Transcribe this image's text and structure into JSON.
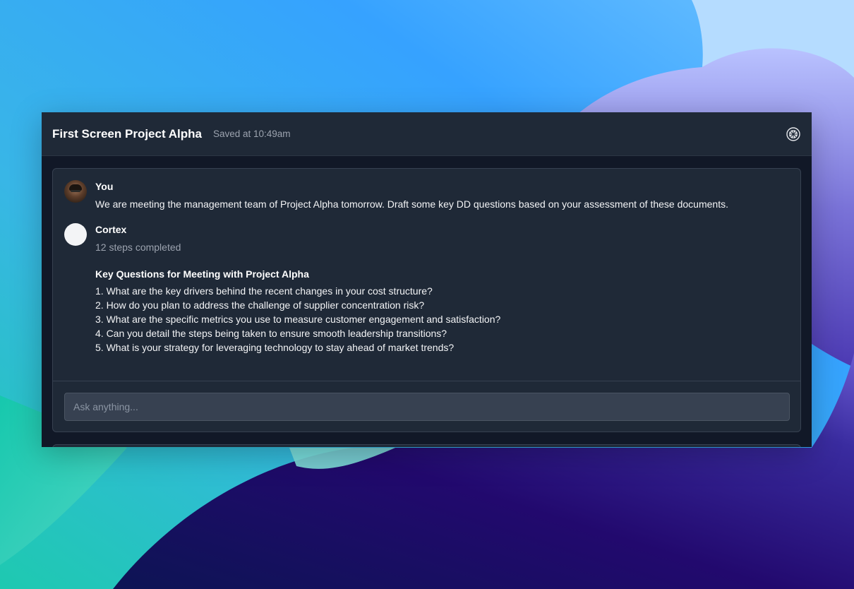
{
  "window": {
    "title": "First Screen Project Alpha",
    "saved_status": "Saved at 10:49am",
    "settings_icon": "settings-icon"
  },
  "conversation": {
    "user_message": {
      "sender": "You",
      "text": "We are meeting the management team of Project Alpha tomorrow. Draft some key DD questions based on your assessment of these documents."
    },
    "assistant_message": {
      "sender": "Cortex",
      "status": "12 steps completed",
      "answer_title": "Key Questions for Meeting with Project Alpha",
      "questions": [
        "1. What are the key drivers behind the recent changes in your cost structure?",
        "2. How do you plan to address the challenge of supplier concentration risk?",
        "3. What are the specific metrics you use to measure customer engagement and satisfaction?",
        "4. Can you detail the steps being taken to ensure smooth leadership transitions?",
        "5. What is your strategy for leveraging technology to stay ahead of market trends?"
      ]
    }
  },
  "composer": {
    "placeholder": "Ask anything..."
  },
  "colors": {
    "window_bg": "#111827",
    "panel_bg": "#1f2937",
    "border": "#374151",
    "input_bg": "#374151",
    "muted_text": "#9ca3af"
  }
}
